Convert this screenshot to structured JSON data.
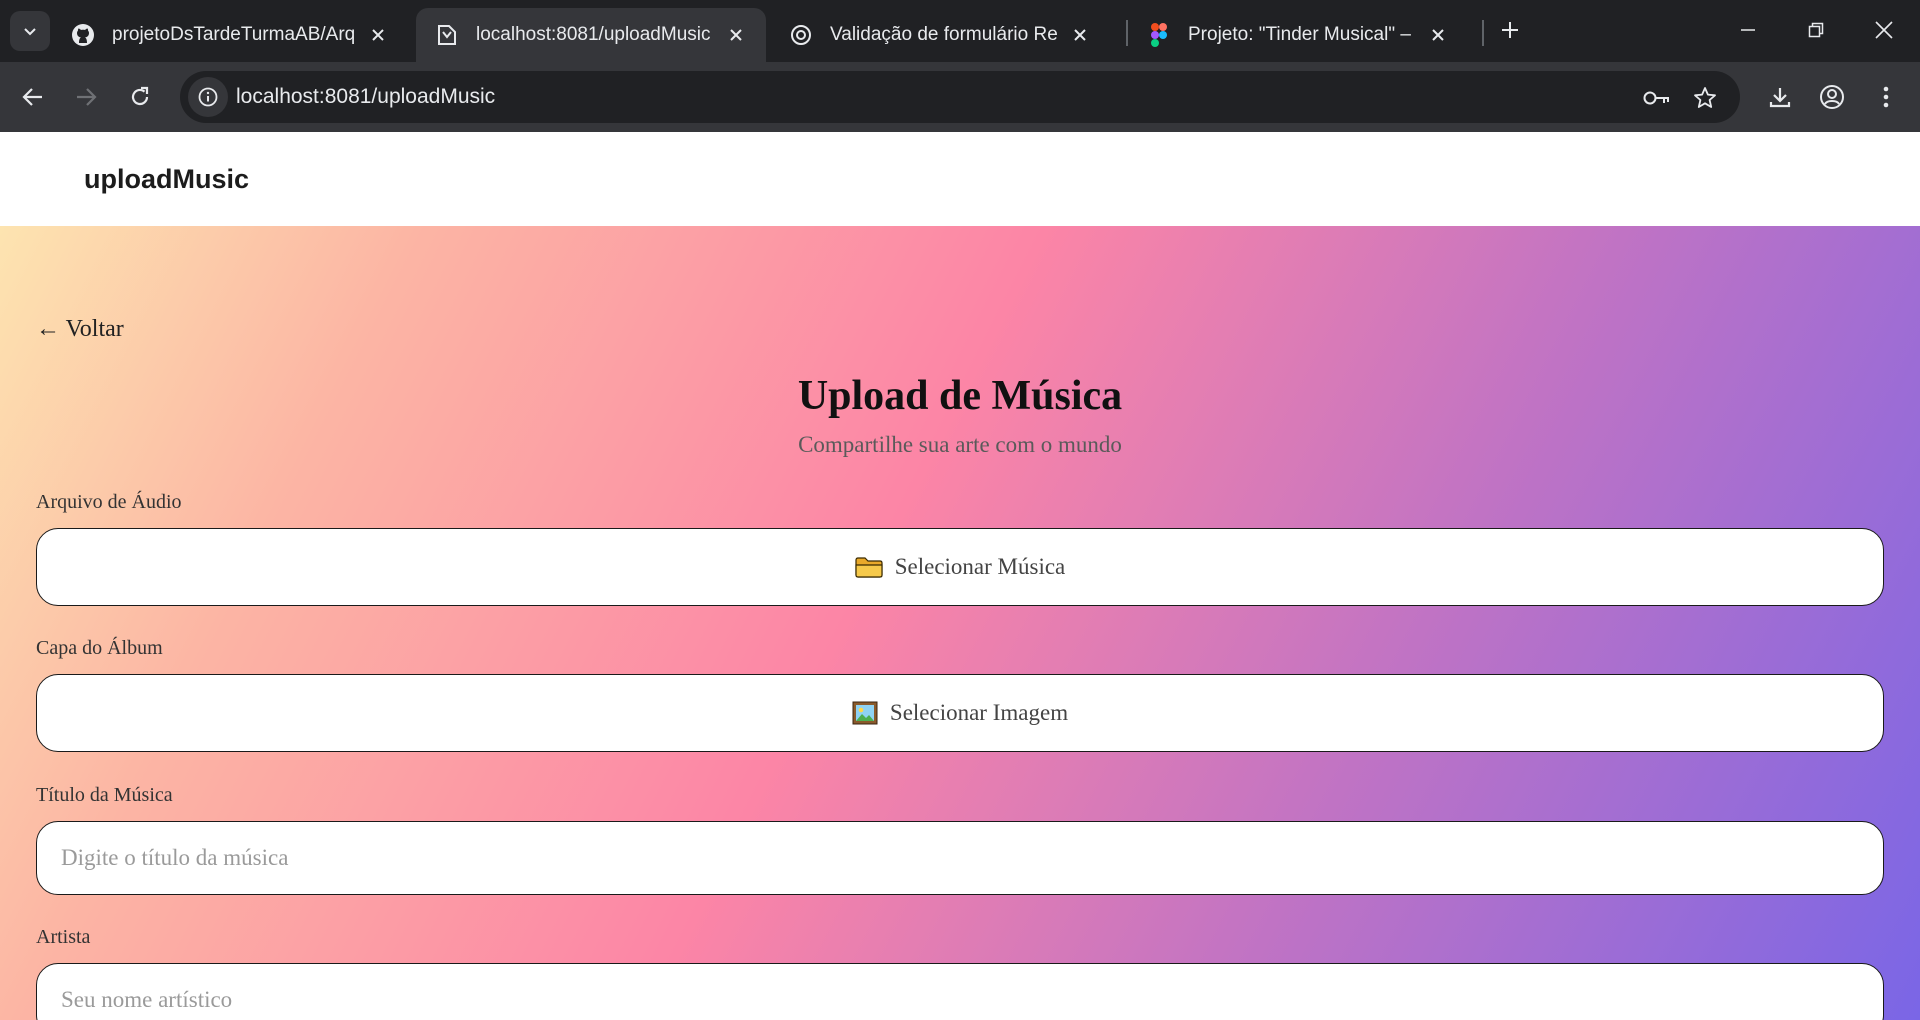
{
  "browser": {
    "tabs": [
      {
        "title": "projetoDsTardeTurmaAB/Arquivo",
        "icon": "github-icon",
        "active": false
      },
      {
        "title": "localhost:8081/uploadMusic",
        "icon": "expo-icon",
        "active": true
      },
      {
        "title": "Validação de formulário React",
        "icon": "chatgpt-icon",
        "active": false
      },
      {
        "title": "Projeto: \"Tinder Musical\" – Figma",
        "icon": "figma-icon",
        "active": false
      }
    ],
    "address": "localhost:8081/uploadMusic"
  },
  "app": {
    "header_title": "uploadMusic"
  },
  "form": {
    "back_label": "← Voltar",
    "title": "Upload de Música",
    "subtitle": "Compartilhe sua arte com o mundo",
    "audio_label": "Arquivo de Áudio",
    "audio_button": "Selecionar Música",
    "cover_label": "Capa do Álbum",
    "cover_button": "Selecionar Imagem",
    "song_title_label": "Título da Música",
    "song_title_placeholder": "Digite o título da música",
    "artist_label": "Artista",
    "artist_placeholder": "Seu nome artístico"
  },
  "colors": {
    "gradient": [
      "#fde4b0",
      "#fc85a6",
      "#7a66e6"
    ],
    "chrome_dark": "#202124",
    "chrome_mid": "#35363a"
  }
}
